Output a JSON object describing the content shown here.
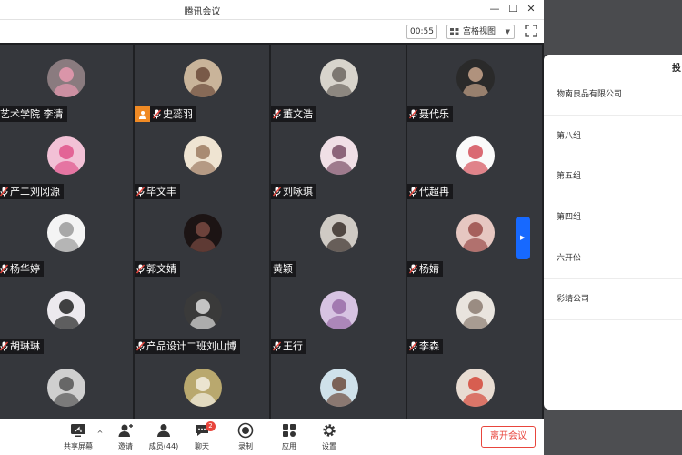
{
  "window": {
    "title": "腾讯会议"
  },
  "toolbar": {
    "timer": "00:55",
    "view_mode": "宫格视图"
  },
  "participants": [
    {
      "name": "艺术学院   李清",
      "bg": "#8a7b7f",
      "fg": "#e89ab0"
    },
    {
      "name": "史蕊羽",
      "bg": "#c9b49a",
      "fg": "#6b4a3a",
      "host": true
    },
    {
      "name": "董文浩",
      "bg": "#d8d4cc",
      "fg": "#6d6660"
    },
    {
      "name": "聂代乐",
      "bg": "#2a2a2a",
      "fg": "#c8a58c"
    },
    {
      "name": "产二刘冈源",
      "bg": "#f2c1d6",
      "fg": "#e0548b"
    },
    {
      "name": "毕文丰",
      "bg": "#efe4d2",
      "fg": "#9c7b62"
    },
    {
      "name": "刘咏琪",
      "bg": "#f0dfe6",
      "fg": "#7a4f66"
    },
    {
      "name": "代超冉",
      "bg": "#fafafa",
      "fg": "#d4505a"
    },
    {
      "name": "杨华婷",
      "bg": "#f4f4f4",
      "fg": "#9a9a9a"
    },
    {
      "name": "郭文婧",
      "bg": "#1c1414",
      "fg": "#7a4a42"
    },
    {
      "name": "黄颖",
      "bg": "#cfcac4",
      "fg": "#3a302c"
    },
    {
      "name": "杨婧",
      "bg": "#e6c7c1",
      "fg": "#9a4d4a"
    },
    {
      "name": "胡琳琳",
      "bg": "#ece9ee",
      "fg": "#222222"
    },
    {
      "name": "产品设计二班刘山博",
      "bg": "#3a3a3a",
      "fg": "#dddddd"
    },
    {
      "name": "王行",
      "bg": "#d7c3e2",
      "fg": "#9a6da8"
    },
    {
      "name": "李森",
      "bg": "#e9e4de",
      "fg": "#8c7d72"
    },
    {
      "name": "",
      "bg": "#cfcfcf",
      "fg": "#555555"
    },
    {
      "name": "",
      "bg": "#b9a86e",
      "fg": "#f3efe2"
    },
    {
      "name": "",
      "bg": "#cfe1ea",
      "fg": "#6c4b3d"
    },
    {
      "name": "",
      "bg": "#e8dcd2",
      "fg": "#d4483a"
    }
  ],
  "bottom_bar": {
    "share_label": "共享屏幕",
    "invite_label": "邀请",
    "members_label": "成员(44)",
    "chat_label": "聊天",
    "chat_badge": "2",
    "record_label": "录制",
    "apps_label": "应用",
    "settings_label": "设置",
    "leave_label": "离开会议"
  },
  "side_panel": {
    "title": "投",
    "items": [
      "物南良品有限公司",
      "第八组",
      "第五组",
      "第四组",
      "六开伀",
      "彩靖公司"
    ]
  },
  "colors": {
    "accent": "#1769ff",
    "danger": "#e8453c",
    "host_tag": "#f08a24"
  }
}
